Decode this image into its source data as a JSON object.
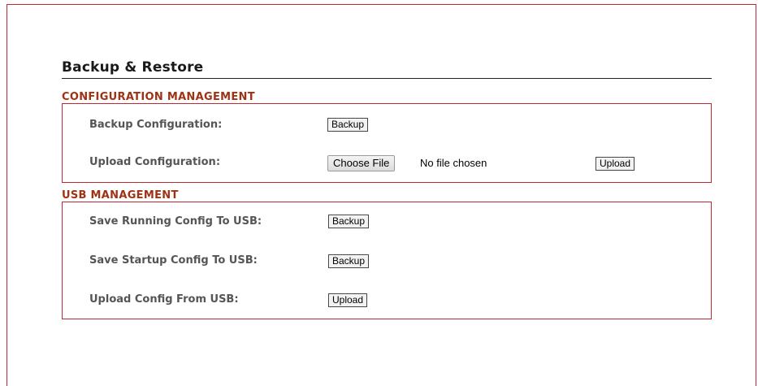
{
  "page": {
    "title": "Backup & Restore"
  },
  "config_section": {
    "title": "CONFIGURATION MANAGEMENT",
    "backup_label": "Backup Configuration:",
    "backup_button": "Backup",
    "upload_label": "Upload Configuration:",
    "choose_file_button": "Choose File",
    "file_status": "No file chosen",
    "upload_button": "Upload"
  },
  "usb_section": {
    "title": "USB MANAGEMENT",
    "rows": [
      {
        "label": "Save Running Config To USB:",
        "button": "Backup"
      },
      {
        "label": "Save Startup Config To USB:",
        "button": "Backup"
      },
      {
        "label": "Upload Config From USB:",
        "button": "Upload"
      }
    ]
  },
  "colors": {
    "border_accent": "#c0282f",
    "section_title": "#a03214",
    "label_text": "#555555"
  }
}
